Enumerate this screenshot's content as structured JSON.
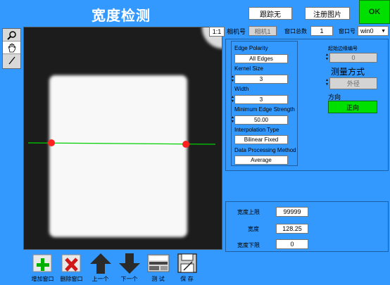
{
  "header": {
    "title": "宽度检测",
    "track_none_label": "跟踪无",
    "register_image_label": "注册图片",
    "ok_label": "OK"
  },
  "viewer": {
    "zoom_label": "1:1"
  },
  "camera_bar": {
    "camera_label": "相机号",
    "camera_value": "相机1",
    "window_total_label": "窗口总数",
    "window_total_value": "1",
    "window_no_label": "窗口号",
    "window_no_value": "win0"
  },
  "params": {
    "edge_polarity_label": "Edge Polarity",
    "edge_polarity_value": "All Edges",
    "kernel_size_label": "Kernel Size",
    "kernel_size_value": "3",
    "width_label": "Width",
    "width_value": "3",
    "min_edge_strength_label": "Minimum Edge Strength",
    "min_edge_strength_value": "50.00",
    "interpolation_label": "Interpolation Type",
    "interpolation_value": "Bilinear Fixed",
    "data_processing_label": "Data Processing Method",
    "data_processing_value": "Average"
  },
  "measurement": {
    "start_edge_label": "起始边缘编号",
    "start_edge_value": "0",
    "method_title": "测量方式",
    "method_value": "外径",
    "direction_label": "方向",
    "direction_value": "正向"
  },
  "results": {
    "upper_limit_label": "宽度上限",
    "upper_limit_value": "99999",
    "width_label": "宽度",
    "width_value": "128.25",
    "lower_limit_label": "宽度下限",
    "lower_limit_value": "0"
  },
  "toolbar": {
    "add_window": "增加窗口",
    "delete_window": "删除窗口",
    "prev": "上一个",
    "next": "下一个",
    "test": "测 试",
    "save": "保 存"
  },
  "colors": {
    "background": "#3399ff",
    "ok_green": "#00e000",
    "line_green": "#00d000",
    "edge_red": "#ff2020"
  }
}
